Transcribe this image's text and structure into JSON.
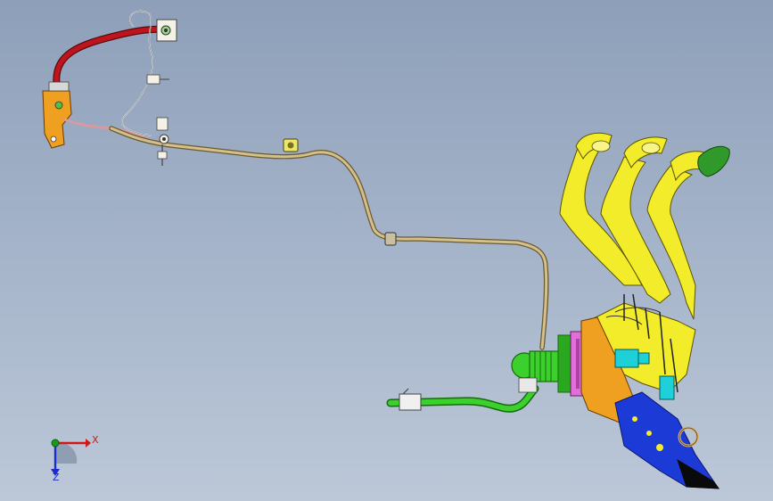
{
  "viewport": {
    "background_top": "#8e9fb9",
    "background_bottom": "#bcc8d8"
  },
  "triad": {
    "x_label": "X",
    "y_label": "",
    "z_label": "Z",
    "x_color": "#d01818",
    "y_color": "#1a9a1a",
    "z_color": "#1b2bd0"
  },
  "colors": {
    "brake_pipe": "#d4c08a",
    "red_hose": "#c0141c",
    "pedal_yellow": "#f2ec2a",
    "bracket_orange": "#f0a020",
    "bracket_blue": "#1c3ad6",
    "hose_green": "#3cd02c",
    "sensor_cyan": "#1ed0d8",
    "flange_magenta": "#e070d8"
  }
}
